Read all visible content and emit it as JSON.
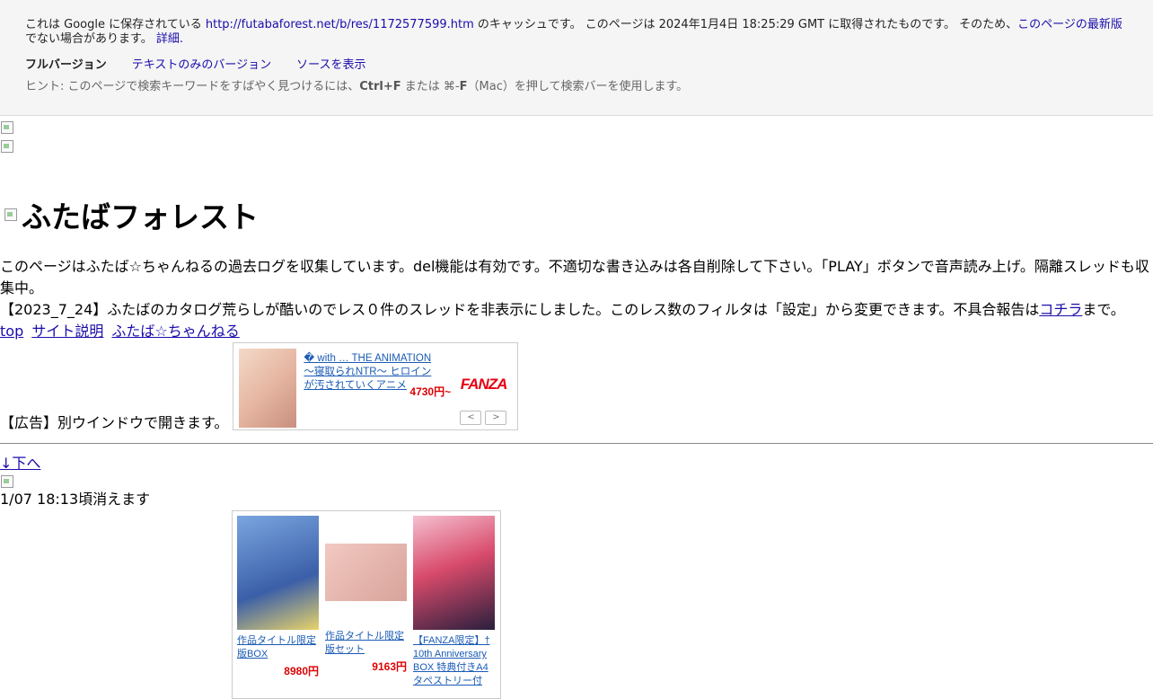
{
  "cache": {
    "prefix": "これは Google に保存されている ",
    "url": "http://futabaforest.net/b/res/1172577599.htm",
    "middle": " のキャッシュです。 このページは 2024年1月4日 18:25:29 GMT に取得されたものです。 そのため、",
    "latest_link": "このページの最新版",
    "suffix": "でない場合があります。",
    "details_link": "詳細.",
    "versions": {
      "full": "フルバージョン",
      "text_only": "テキストのみのバージョン",
      "source": "ソースを表示"
    },
    "hint_prefix": "ヒント: このページで検索キーワードをすばやく見つけるには、",
    "hint_key1": "Ctrl+F",
    "hint_mid": " または ⌘-",
    "hint_key2": "F",
    "hint_suffix": "（Mac）を押して検索バーを使用します。"
  },
  "site": {
    "title": "ふたばフォレスト",
    "intro": "このページはふたば☆ちゃんねるの過去ログを収集しています。del機能は有効です。不適切な書き込みは各自削除して下さい。「PLAY」ボタンで音声読み上げ。隔離スレッドも収集中。",
    "notice_prefix": "【2023_7_24】ふたばのカタログ荒らしが酷いのでレス０件のスレッドを非表示にしました。このレス数のフィルタは「設定」から変更できます。不具合報告は",
    "notice_link": "コチラ",
    "notice_suffix": "まで。",
    "nav": [
      "top",
      "サイト説明",
      "ふたば☆ちゃんねる"
    ]
  },
  "ad1": {
    "label": "【広告】別ウインドウで開きます。",
    "title": "� with … THE ANIMATION 〜寝取られNTR〜 ヒロインが汚されていくアニメ",
    "price": "4730円~",
    "logo": "FANZA"
  },
  "thread": {
    "down_link": "↓下へ",
    "expire": "1/07 18:13頃消えます"
  },
  "ad2": {
    "items": [
      {
        "title": "作品タイトル限定版BOX",
        "price": "8980円",
        "colors": [
          "#7aa6e0",
          "#3b5fa8"
        ]
      },
      {
        "title": "作品タイトル限定版セット",
        "price": "9163円",
        "colors": [
          "#f2c9c2",
          "#d8a39a"
        ]
      },
      {
        "title": "【FANZA限定】†10th Anniversary BOX 特典付きA4タペストリー付",
        "price": "",
        "colors": [
          "#d84a6b",
          "#2a1f3d"
        ]
      }
    ]
  }
}
